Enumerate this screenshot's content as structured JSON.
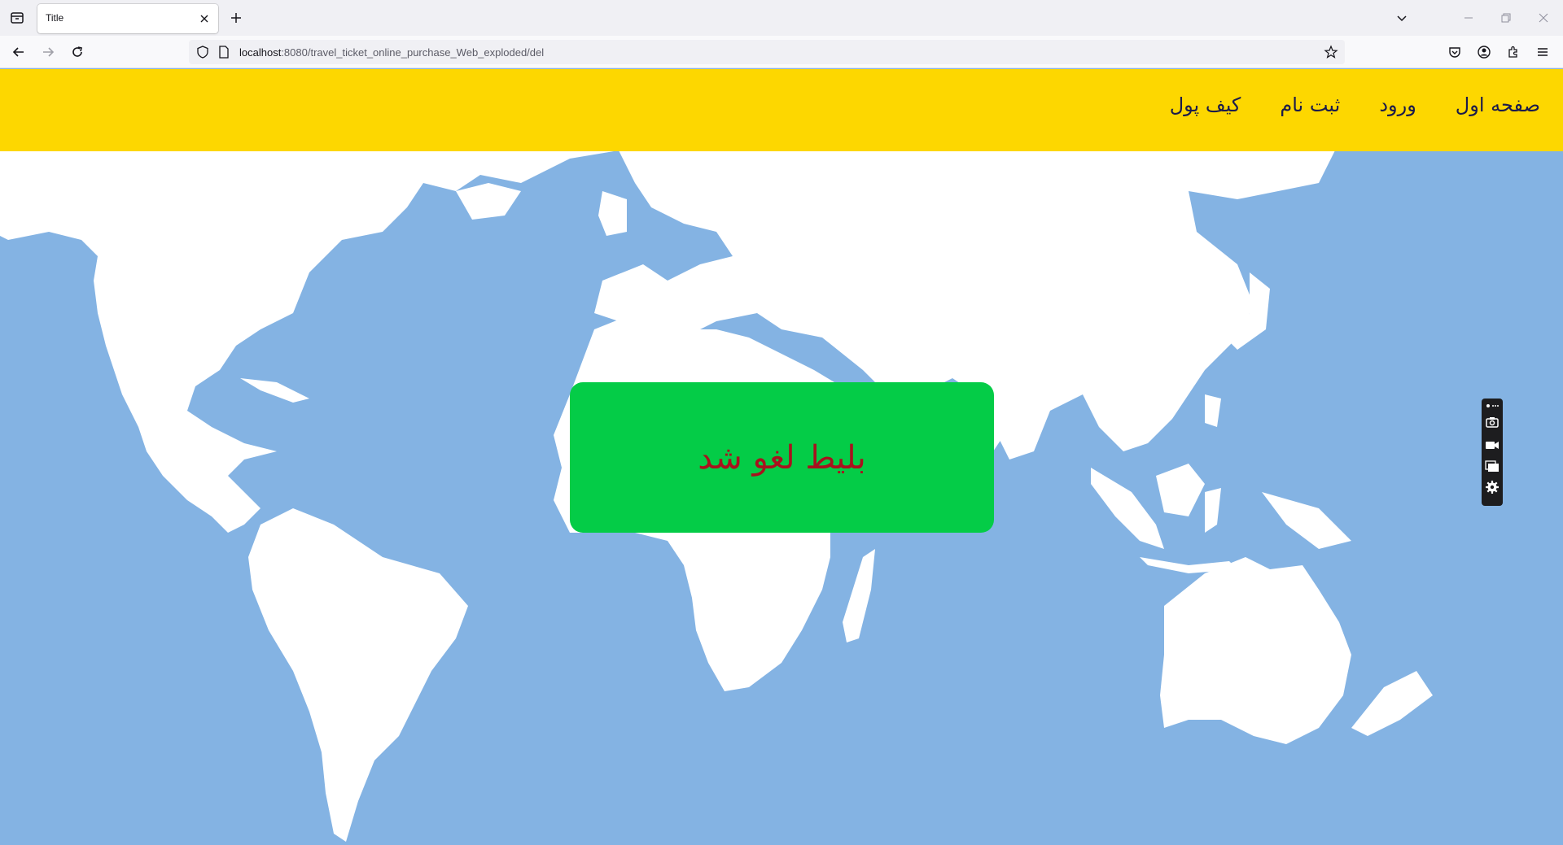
{
  "browser": {
    "tab_title": "Title",
    "url_host": "localhost",
    "url_rest": ":8080/travel_ticket_online_purchase_Web_exploded/del"
  },
  "header": {
    "menu": [
      {
        "label": "صفحه اول"
      },
      {
        "label": "ورود"
      },
      {
        "label": "ثبت نام"
      },
      {
        "label": "کیف پول"
      }
    ],
    "background": "#fdd700"
  },
  "notice": {
    "message": "بلیط لغو شد",
    "background": "#04cc47",
    "text_color": "#a8121e"
  },
  "colors": {
    "ocean": "#84b3e3",
    "land": "#ffffff"
  },
  "side_tools": [
    "camera-icon",
    "video-icon",
    "window-icon",
    "settings-icon"
  ]
}
